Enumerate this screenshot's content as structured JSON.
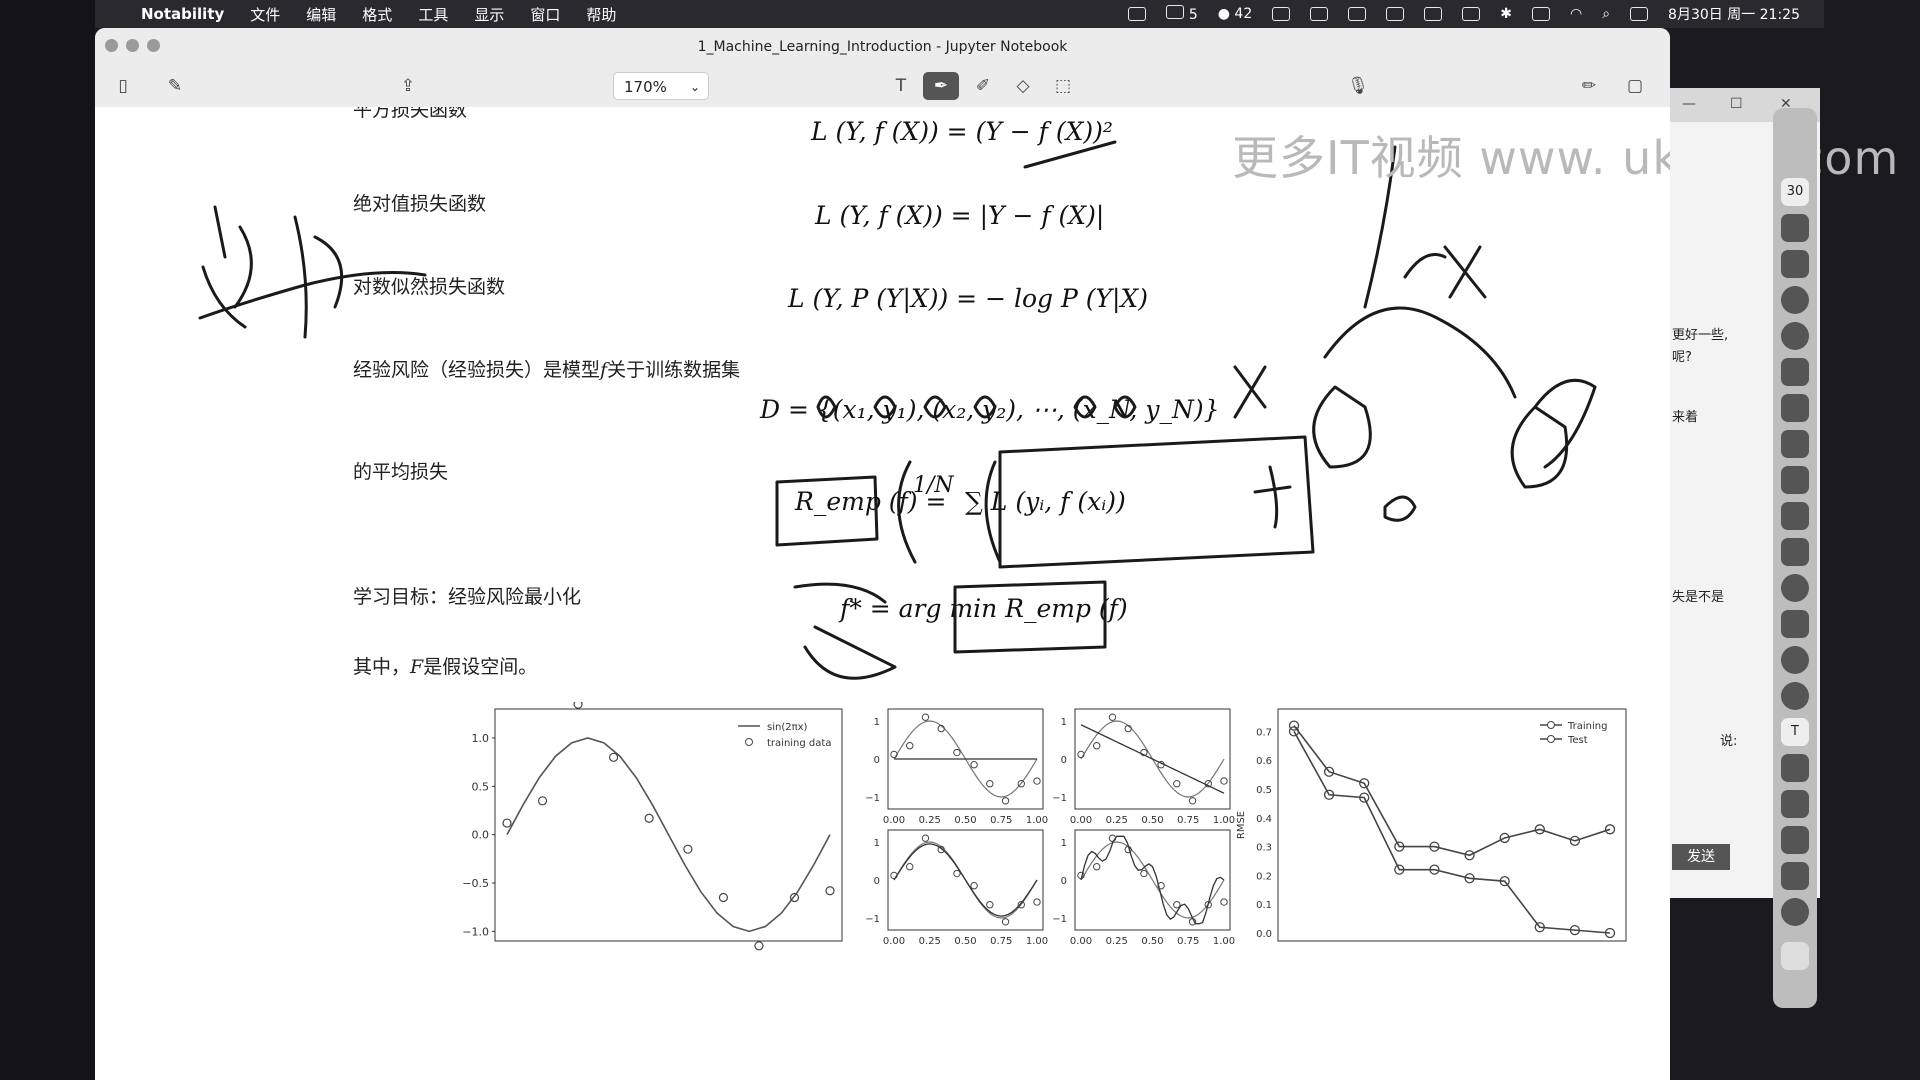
{
  "menubar": {
    "app_name": "Notability",
    "items": [
      "文件",
      "编辑",
      "格式",
      "工具",
      "显示",
      "窗口",
      "帮助"
    ],
    "wechat_count": "5",
    "badge_count": "42",
    "clock": "8月30日 周一  21:25"
  },
  "window": {
    "title": "1_Machine_Learning_Introduction - Jupyter Notebook",
    "zoom": "170%"
  },
  "notebook": {
    "text_truncated": "平方损失函数",
    "label_abs_loss": "绝对值损失函数",
    "label_log_loss": "对数似然损失函数",
    "label_empirical_risk": "经验风险（经验损失）是模型",
    "label_empirical_risk_f": "f",
    "label_empirical_risk_tail": "关于训练数据集",
    "label_average_loss": "的平均损失",
    "label_objective": "学习目标：经验风险最小化",
    "label_where": "其中，",
    "label_where_F": "F",
    "label_where_tail": "是假设空间。",
    "formula_square": "L (Y, f (X)) = (Y − f (X))²",
    "formula_abs": "L (Y, f (X)) = |Y − f (X)|",
    "formula_log": "L (Y, P (Y|X)) = − log P (Y|X)",
    "formula_dataset": "D = {(x₁, y₁), (x₂, y₂), ⋯, (x_N, y_N)}",
    "formula_remp_lhs": "R_emp (f) =",
    "formula_remp_frac": "1/N",
    "formula_remp_sum": "∑ L (yᵢ, f (xᵢ))",
    "formula_argmin": "f* = arg min R_emp (f)"
  },
  "watermark": "更多IT视频  www. ukoou. com",
  "right_panel": {
    "lines": [
      "更好一些,",
      "呢?",
      "来着",
      "失是不是",
      "说:"
    ],
    "send_button": "发送"
  },
  "dock": {
    "badge": "30",
    "icons": [
      "calendar-icon",
      "vscode-icon",
      "chrome-icon",
      "app-icon",
      "terminal-icon",
      "qq-icon",
      "wechat-icon",
      "folder-icon",
      "notes-icon",
      "github-icon",
      "text-icon",
      "mail-icon",
      "preview-icon",
      "books-icon",
      "camera-icon",
      "pen-icon",
      "trash-icon"
    ]
  },
  "chart_data": [
    {
      "type": "scatter",
      "title": "",
      "legend": [
        "sin(2πx)",
        "training data"
      ],
      "legend_position": "top-right",
      "ylim": [
        -1.1,
        1.3
      ],
      "yticks": [
        "1.0",
        "0.5",
        "0.0",
        "−0.5",
        "−1.0"
      ],
      "series": [
        {
          "name": "sin(2πx)",
          "kind": "line",
          "x": [
            0,
            0.05,
            0.1,
            0.15,
            0.2,
            0.25,
            0.3,
            0.35,
            0.4,
            0.45,
            0.5,
            0.55,
            0.6,
            0.65,
            0.7,
            0.75,
            0.8,
            0.85,
            0.9,
            0.95,
            1.0
          ],
          "y": [
            0,
            0.31,
            0.59,
            0.81,
            0.95,
            1.0,
            0.95,
            0.81,
            0.59,
            0.31,
            0,
            -0.31,
            -0.59,
            -0.81,
            -0.95,
            -1.0,
            -0.95,
            -0.81,
            -0.59,
            -0.31,
            0
          ]
        },
        {
          "name": "training data",
          "kind": "points",
          "x": [
            0,
            0.11,
            0.22,
            0.33,
            0.44,
            0.56,
            0.67,
            0.78,
            0.89,
            1.0
          ],
          "y": [
            0.12,
            0.35,
            1.35,
            0.8,
            0.17,
            -0.15,
            -0.65,
            -1.15,
            -0.65,
            -0.58
          ]
        }
      ]
    },
    {
      "type": "line",
      "panels": 4,
      "xticks": [
        "0.00",
        "0.25",
        "0.50",
        "0.75",
        "1.00"
      ],
      "yticks": [
        "1",
        "0",
        "−1"
      ],
      "note": "polynomial fits of increasing degree to the training data"
    },
    {
      "type": "line",
      "legend": [
        "Training",
        "Test"
      ],
      "legend_position": "top-right",
      "ylabel": "RMSE",
      "ylim": [
        0.0,
        0.75
      ],
      "yticks": [
        "0.7",
        "0.6",
        "0.5",
        "0.4",
        "0.3",
        "0.2",
        "0.1",
        "0.0"
      ],
      "x": [
        0,
        1,
        2,
        3,
        4,
        5,
        6,
        7,
        8,
        9
      ],
      "series": [
        {
          "name": "Training",
          "values": [
            0.7,
            0.48,
            0.47,
            0.22,
            0.22,
            0.19,
            0.18,
            0.02,
            0.01,
            0.0
          ]
        },
        {
          "name": "Test",
          "values": [
            0.72,
            0.56,
            0.52,
            0.3,
            0.3,
            0.27,
            0.33,
            0.36,
            0.32,
            0.36
          ]
        }
      ]
    }
  ],
  "colors": {
    "menubar": "#2a2a2e",
    "ink": "#1a1a1a",
    "active_tool": "#555555"
  }
}
